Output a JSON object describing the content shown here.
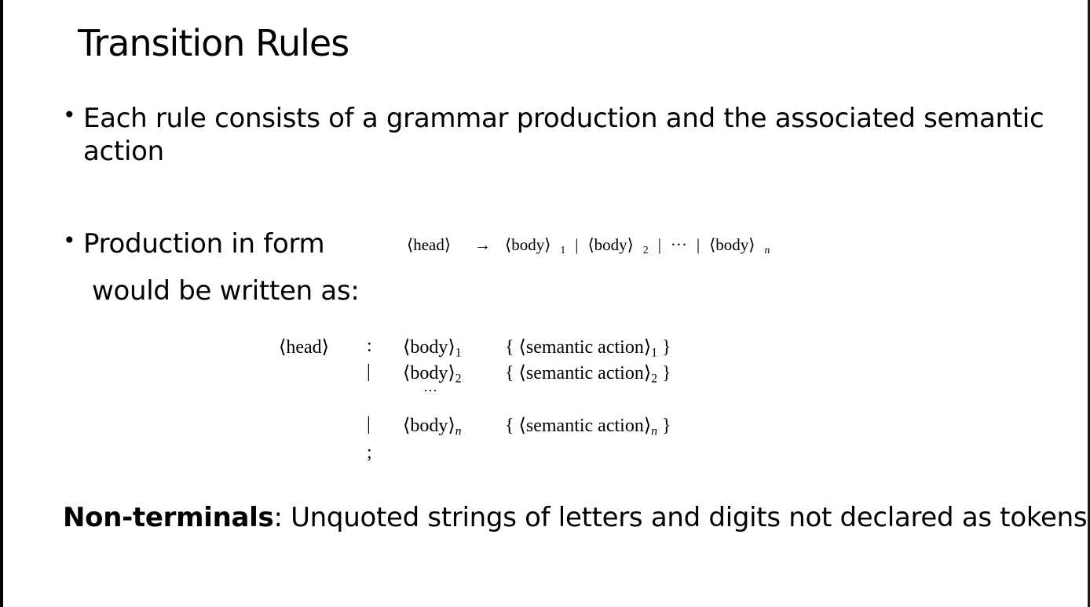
{
  "slide": {
    "title": "Transition Rules",
    "bullets": [
      {
        "text": "Each rule consists of a grammar production and the associated semantic action"
      },
      {
        "text": "Production in form",
        "continuation": "would be written as:"
      }
    ],
    "production": {
      "head": "⟨head⟩",
      "arrow": "→",
      "body": "⟨body⟩",
      "bar": "|",
      "dots": "···",
      "sub1": "1",
      "sub2": "2",
      "subn": "n"
    },
    "grammar": {
      "head": "⟨head⟩",
      "colon": ":",
      "bar": "|",
      "semicolon": ";",
      "ellipsis": "···",
      "body": "⟨body⟩",
      "action_open": "{ ⟨semantic action⟩",
      "action_close": " }",
      "sub1": "1",
      "sub2": "2",
      "subn": "n"
    },
    "footer": {
      "term": "Non-terminals",
      "definition": ": Unquoted strings of letters and digits not declared as tokens"
    }
  }
}
